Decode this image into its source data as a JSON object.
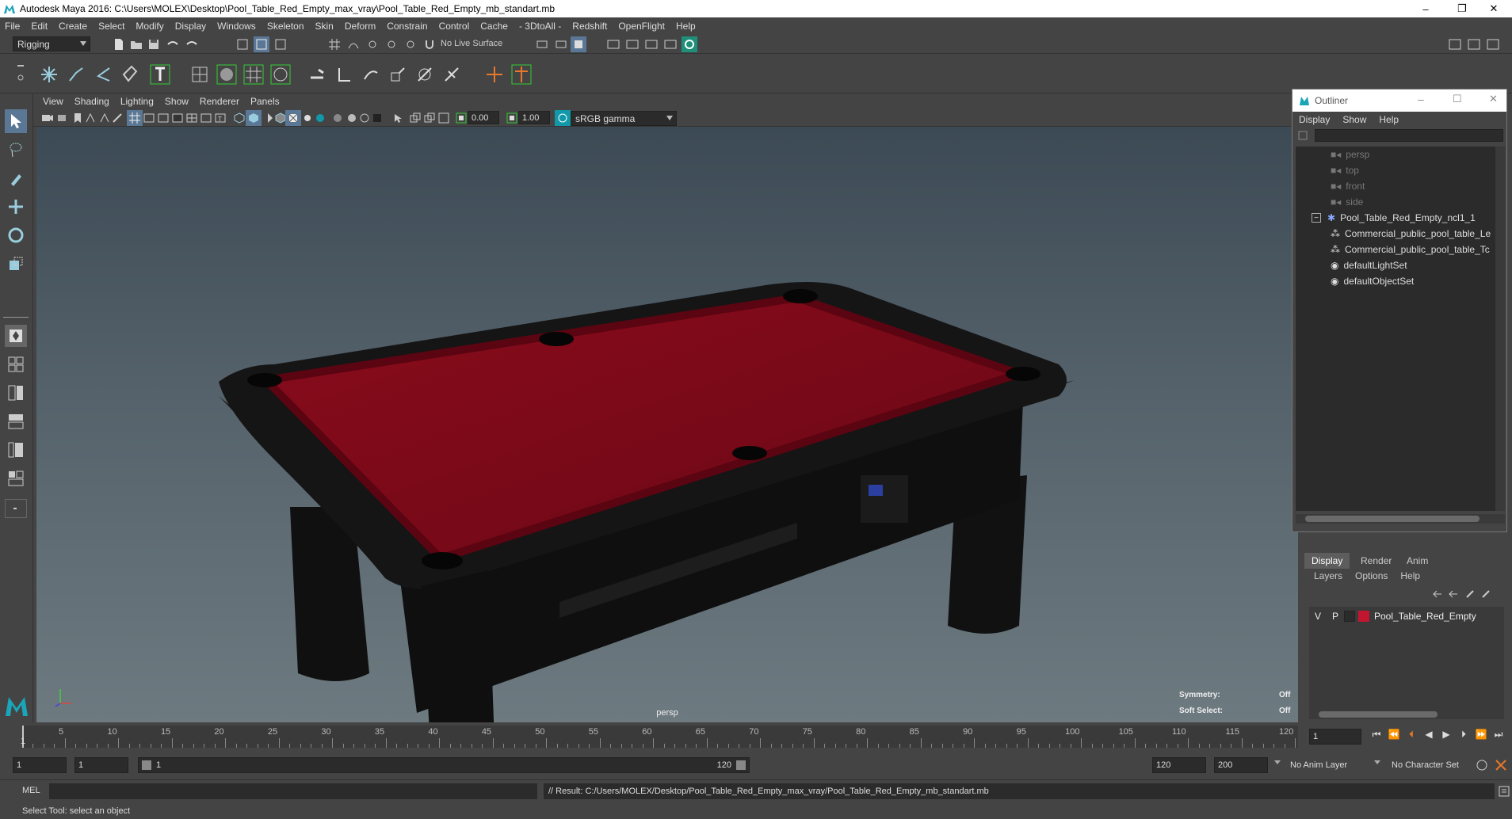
{
  "window": {
    "title": "Autodesk Maya 2016: C:\\Users\\MOLEX\\Desktop\\Pool_Table_Red_Empty_max_vray\\Pool_Table_Red_Empty_mb_standart.mb",
    "minimize": "–",
    "restore": "❐",
    "close": "✕"
  },
  "menubar": [
    "File",
    "Edit",
    "Create",
    "Select",
    "Modify",
    "Display",
    "Windows",
    "Skeleton",
    "Skin",
    "Deform",
    "Constrain",
    "Control",
    "Cache",
    "- 3DtoAll -",
    "Redshift",
    "OpenFlight",
    "Help"
  ],
  "statusline": {
    "mode": "Rigging",
    "live_surface": "No Live Surface"
  },
  "viewport": {
    "menus": [
      "View",
      "Shading",
      "Lighting",
      "Show",
      "Renderer",
      "Panels"
    ],
    "near_value": "0.00",
    "far_value": "1.00",
    "color_space": "sRGB gamma",
    "camera": "persp",
    "hud": {
      "symmetry_label": "Symmetry:",
      "symmetry_value": "Off",
      "soft_select_label": "Soft Select:",
      "soft_select_value": "Off"
    }
  },
  "outliner": {
    "title": "Outliner",
    "menus": [
      "Display",
      "Show",
      "Help"
    ],
    "items": [
      {
        "label": "persp",
        "dim": true
      },
      {
        "label": "top",
        "dim": true
      },
      {
        "label": "front",
        "dim": true
      },
      {
        "label": "side",
        "dim": true
      },
      {
        "label": "Pool_Table_Red_Empty_ncl1_1",
        "dim": false
      },
      {
        "label": "Commercial_public_pool_table_Le",
        "dim": false
      },
      {
        "label": "Commercial_public_pool_table_Tc",
        "dim": false
      },
      {
        "label": "defaultLightSet",
        "dim": false
      },
      {
        "label": "defaultObjectSet",
        "dim": false
      }
    ]
  },
  "layers": {
    "tabs": [
      "Display",
      "Render",
      "Anim"
    ],
    "menus": [
      "Layers",
      "Options",
      "Help"
    ],
    "row": {
      "v": "V",
      "p": "P",
      "name": "Pool_Table_Red_Empty",
      "color": "#c2152f"
    }
  },
  "timeline": {
    "ticks": [
      "5",
      "10",
      "15",
      "20",
      "25",
      "30",
      "35",
      "40",
      "45",
      "50",
      "55",
      "60",
      "65",
      "70",
      "75",
      "80",
      "85",
      "90",
      "95",
      "100",
      "105",
      "110",
      "115",
      "120"
    ],
    "start_marker": "1",
    "current_frame": "1"
  },
  "range": {
    "start": "1",
    "playback_start": "1",
    "slider_start": "1",
    "slider_end": "120",
    "playback_end": "120",
    "end": "200",
    "anim_layer": "No Anim Layer",
    "character_set": "No Character Set"
  },
  "cmdline": {
    "lang": "MEL",
    "result": "// Result: C:/Users/MOLEX/Desktop/Pool_Table_Red_Empty_max_vray/Pool_Table_Red_Empty_mb_standart.mb"
  },
  "helpline": "Select Tool: select an object",
  "colors": {
    "felt": "#7a0a18",
    "table_body": "#121212",
    "accent": "#39c8c0"
  }
}
